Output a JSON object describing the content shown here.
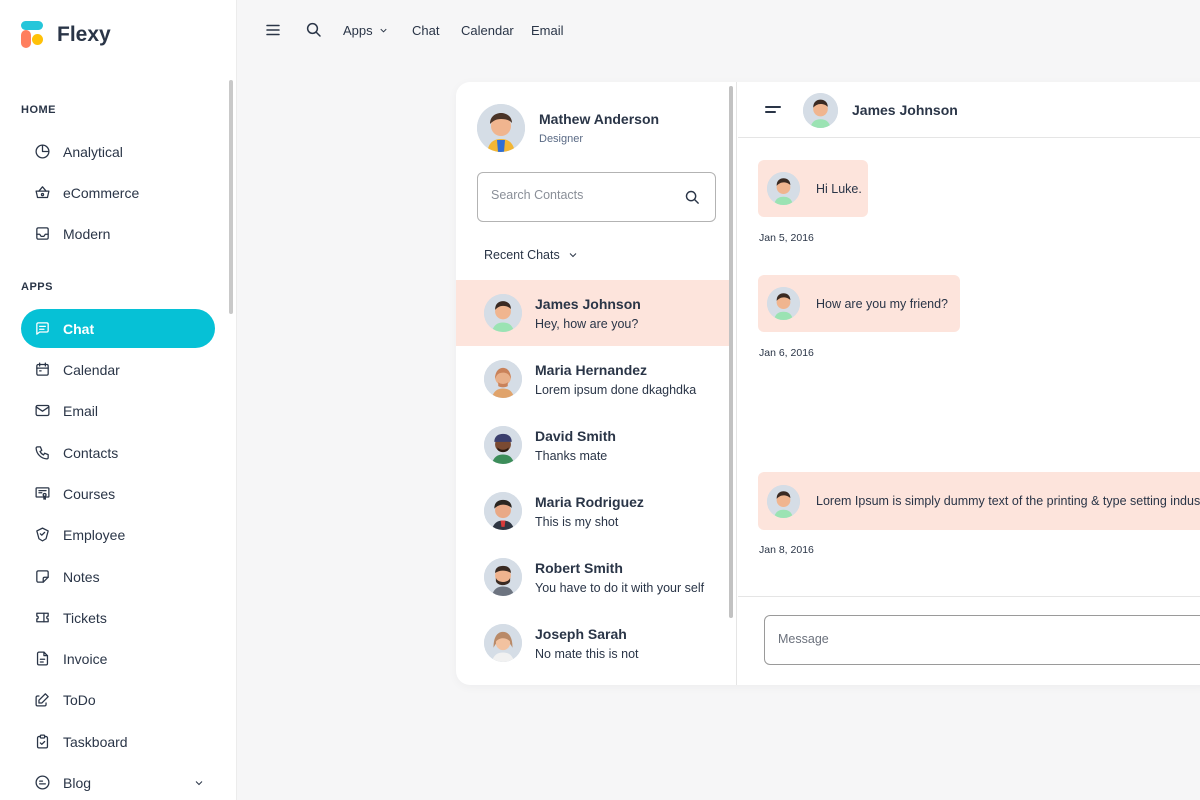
{
  "brand": {
    "name": "Flexy",
    "colors": {
      "cyan": "#26c6da",
      "coral": "#ff7f5e",
      "yellow": "#ffc107"
    }
  },
  "sidebar": {
    "sections": [
      {
        "label": "HOME",
        "items": [
          {
            "label": "Analytical",
            "icon": "pie-chart-icon"
          },
          {
            "label": "eCommerce",
            "icon": "basket-icon"
          },
          {
            "label": "Modern",
            "icon": "inbox-icon"
          }
        ]
      },
      {
        "label": "APPS",
        "items": [
          {
            "label": "Chat",
            "icon": "message-icon",
            "active": true
          },
          {
            "label": "Calendar",
            "icon": "calendar-icon"
          },
          {
            "label": "Email",
            "icon": "mail-icon"
          },
          {
            "label": "Contacts",
            "icon": "phone-icon"
          },
          {
            "label": "Courses",
            "icon": "certificate-icon"
          },
          {
            "label": "Employee",
            "icon": "shield-icon"
          },
          {
            "label": "Notes",
            "icon": "note-icon"
          },
          {
            "label": "Tickets",
            "icon": "ticket-icon"
          },
          {
            "label": "Invoice",
            "icon": "file-invoice-icon"
          },
          {
            "label": "ToDo",
            "icon": "edit-icon"
          },
          {
            "label": "Taskboard",
            "icon": "clipboard-check-icon"
          },
          {
            "label": "Blog",
            "icon": "brand-blogger-icon",
            "has_children": true
          }
        ]
      }
    ],
    "active_color": "#06c1d6"
  },
  "topbar": {
    "links": [
      {
        "label": "Apps",
        "dropdown": true
      },
      {
        "label": "Chat"
      },
      {
        "label": "Calendar"
      },
      {
        "label": "Email"
      }
    ]
  },
  "chat": {
    "me": {
      "name": "Mathew Anderson",
      "role": "Designer"
    },
    "search": {
      "placeholder": "Search Contacts"
    },
    "recent_label": "Recent Chats",
    "contacts": [
      {
        "name": "James Johnson",
        "last": "Hey, how are you?",
        "active": true
      },
      {
        "name": "Maria Hernandez",
        "last": "Lorem ipsum done dkaghdka"
      },
      {
        "name": "David Smith",
        "last": "Thanks mate"
      },
      {
        "name": "Maria Rodriguez",
        "last": "This is my shot"
      },
      {
        "name": "Robert Smith",
        "last": "You have to do it with your self"
      },
      {
        "name": "Joseph Sarah",
        "last": "No mate this is not"
      }
    ],
    "conversation": {
      "with": "James Johnson",
      "messages": [
        {
          "text": "Hi Luke.",
          "date": "Jan 5, 2016"
        },
        {
          "text": "How are you my friend?",
          "date": "Jan 6, 2016"
        },
        {
          "text": "Lorem Ipsum is simply dummy text of the printing & type setting industry.",
          "date": "Jan 8, 2016"
        }
      ],
      "input_placeholder": "Message"
    },
    "bubble_color": "#fde4dc"
  }
}
